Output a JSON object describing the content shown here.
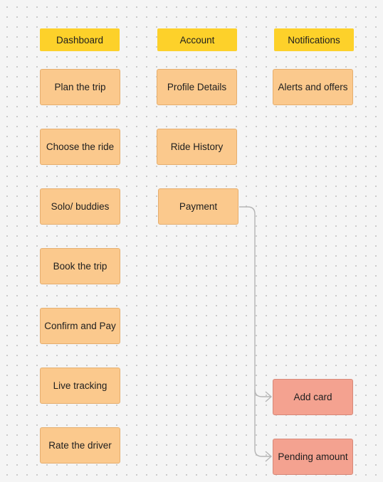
{
  "columns": [
    {
      "header": "Dashboard",
      "items": [
        "Plan the trip",
        "Choose the ride",
        "Solo/ buddies",
        "Book the trip",
        "Confirm and Pay",
        "Live tracking",
        "Rate the driver"
      ]
    },
    {
      "header": "Account",
      "items": [
        "Profile Details",
        "Ride History",
        "Payment"
      ]
    },
    {
      "header": "Notifications",
      "items": [
        "Alerts and offers"
      ]
    }
  ],
  "payment_options": [
    "Add card",
    "Pending amount"
  ],
  "colors": {
    "header": "#fdd12a",
    "card": "#fbc98d",
    "card_border": "#e6ae6e",
    "highlight_card": "#f4a290",
    "highlight_border": "#d78878",
    "connector": "#b5b5b5",
    "canvas": "#f5f5f5"
  },
  "connections": [
    {
      "from": "Payment",
      "to": "Add card"
    },
    {
      "from": "Payment",
      "to": "Pending amount"
    }
  ]
}
